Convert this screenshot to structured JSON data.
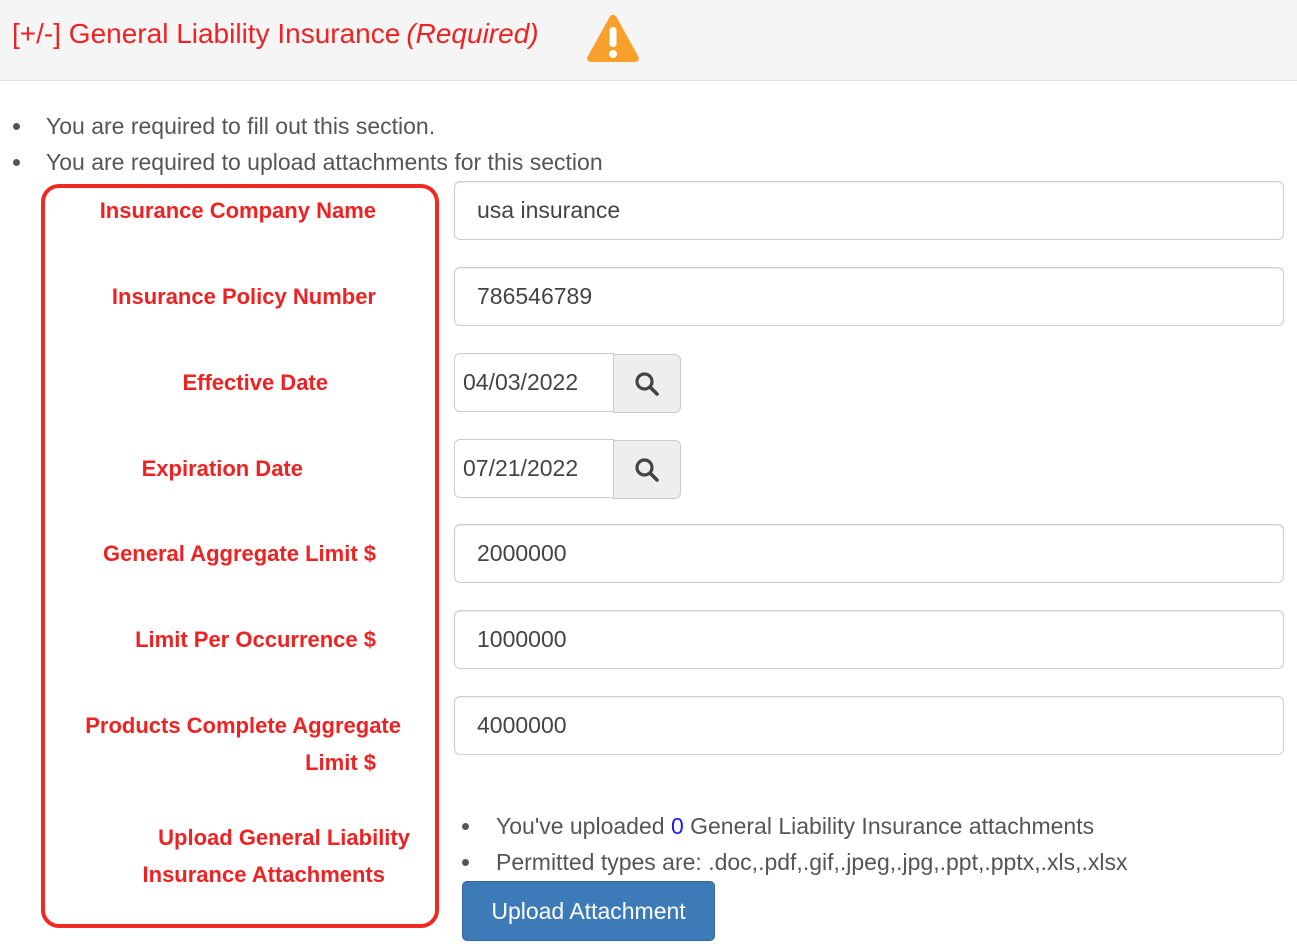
{
  "header": {
    "toggle": "[+/-]",
    "title": "General Liability Insurance",
    "required_label": "(Required)",
    "icon": "warning-triangle-icon",
    "title_color": "#ee2222",
    "icon_color": "#f9a02a"
  },
  "notes": [
    "You are required to fill out this section.",
    "You are required to upload attachments for this section"
  ],
  "fields": {
    "company_name": {
      "label": "Insurance Company Name",
      "value": "usa insurance"
    },
    "policy_number": {
      "label": "Insurance Policy Number",
      "value": "786546789"
    },
    "effective_date": {
      "label": "Effective Date",
      "value": "04/03/2022",
      "button_icon": "search-icon"
    },
    "expiration_date": {
      "label": "Expiration Date",
      "value": "07/21/2022",
      "button_icon": "search-icon"
    },
    "general_aggregate": {
      "label": "General Aggregate Limit $",
      "value": "2000000"
    },
    "per_occurrence": {
      "label": "Limit Per Occurrence $",
      "value": "1000000"
    },
    "products_aggregate": {
      "label_line1": "Products Complete Aggregate",
      "label_line2": "Limit $",
      "value": "4000000"
    },
    "upload": {
      "label_line1": "Upload General Liability",
      "label_line2": "Insurance Attachments"
    }
  },
  "upload": {
    "uploaded_prefix": "You've uploaded",
    "uploaded_count": "0",
    "uploaded_suffix": "General Liability Insurance attachments",
    "permitted": "Permitted types are: .doc,.pdf,.gif,.jpeg,.jpg,.ppt,.pptx,.xls,.xlsx",
    "button_label": "Upload Attachment",
    "button_color": "#3d7ab8"
  },
  "annotation": {
    "box_color": "#ee2a22"
  }
}
